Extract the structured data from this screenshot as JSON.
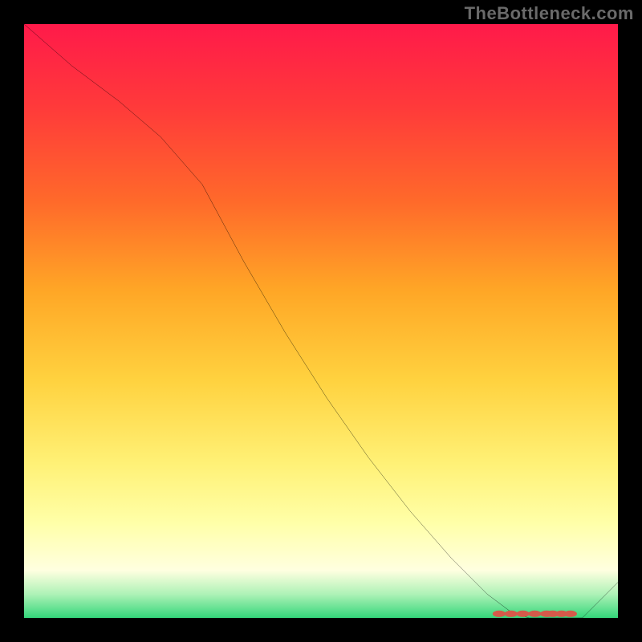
{
  "watermark": "TheBottleneck.com",
  "chart_data": {
    "type": "line",
    "title": "",
    "subtitle": "",
    "xlabel": "",
    "ylabel": "",
    "xlim": [
      0,
      100
    ],
    "ylim": [
      0,
      100
    ],
    "gradient_stops": [
      {
        "pos": 0,
        "color": "#ff1a4a"
      },
      {
        "pos": 14,
        "color": "#ff3a3a"
      },
      {
        "pos": 30,
        "color": "#ff6a2a"
      },
      {
        "pos": 45,
        "color": "#ffa726"
      },
      {
        "pos": 60,
        "color": "#ffd23f"
      },
      {
        "pos": 74,
        "color": "#fff176"
      },
      {
        "pos": 84,
        "color": "#ffffa8"
      },
      {
        "pos": 92,
        "color": "#ffffe0"
      },
      {
        "pos": 96,
        "color": "#aef2b7"
      },
      {
        "pos": 100,
        "color": "#34d67a"
      }
    ],
    "series": [
      {
        "name": "bottleneck-curve",
        "color": "#000000",
        "x": [
          0,
          8,
          16,
          23,
          30,
          37,
          44,
          51,
          58,
          65,
          72,
          78,
          82,
          85,
          88,
          91,
          94,
          100
        ],
        "y": [
          100,
          93,
          87,
          81,
          73,
          60,
          48,
          37,
          27,
          18,
          10,
          4,
          1,
          0,
          0,
          0,
          0,
          6
        ]
      }
    ],
    "markers": {
      "name": "valley-dots",
      "color": "#d55a4a",
      "x": [
        80,
        82,
        84,
        86,
        88,
        89,
        90.5,
        92
      ],
      "y": [
        0.7,
        0.7,
        0.7,
        0.7,
        0.7,
        0.7,
        0.7,
        0.7
      ]
    }
  }
}
